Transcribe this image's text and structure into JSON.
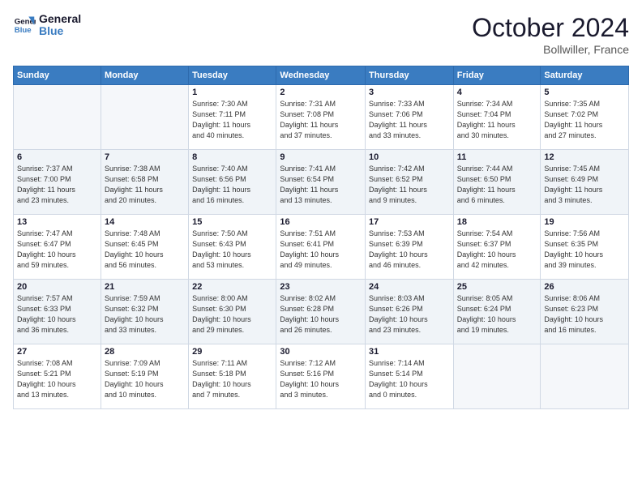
{
  "header": {
    "logo_line1": "General",
    "logo_line2": "Blue",
    "month": "October 2024",
    "location": "Bollwiller, France"
  },
  "weekdays": [
    "Sunday",
    "Monday",
    "Tuesday",
    "Wednesday",
    "Thursday",
    "Friday",
    "Saturday"
  ],
  "weeks": [
    [
      {
        "day": "",
        "info": ""
      },
      {
        "day": "",
        "info": ""
      },
      {
        "day": "1",
        "info": "Sunrise: 7:30 AM\nSunset: 7:11 PM\nDaylight: 11 hours\nand 40 minutes."
      },
      {
        "day": "2",
        "info": "Sunrise: 7:31 AM\nSunset: 7:08 PM\nDaylight: 11 hours\nand 37 minutes."
      },
      {
        "day": "3",
        "info": "Sunrise: 7:33 AM\nSunset: 7:06 PM\nDaylight: 11 hours\nand 33 minutes."
      },
      {
        "day": "4",
        "info": "Sunrise: 7:34 AM\nSunset: 7:04 PM\nDaylight: 11 hours\nand 30 minutes."
      },
      {
        "day": "5",
        "info": "Sunrise: 7:35 AM\nSunset: 7:02 PM\nDaylight: 11 hours\nand 27 minutes."
      }
    ],
    [
      {
        "day": "6",
        "info": "Sunrise: 7:37 AM\nSunset: 7:00 PM\nDaylight: 11 hours\nand 23 minutes."
      },
      {
        "day": "7",
        "info": "Sunrise: 7:38 AM\nSunset: 6:58 PM\nDaylight: 11 hours\nand 20 minutes."
      },
      {
        "day": "8",
        "info": "Sunrise: 7:40 AM\nSunset: 6:56 PM\nDaylight: 11 hours\nand 16 minutes."
      },
      {
        "day": "9",
        "info": "Sunrise: 7:41 AM\nSunset: 6:54 PM\nDaylight: 11 hours\nand 13 minutes."
      },
      {
        "day": "10",
        "info": "Sunrise: 7:42 AM\nSunset: 6:52 PM\nDaylight: 11 hours\nand 9 minutes."
      },
      {
        "day": "11",
        "info": "Sunrise: 7:44 AM\nSunset: 6:50 PM\nDaylight: 11 hours\nand 6 minutes."
      },
      {
        "day": "12",
        "info": "Sunrise: 7:45 AM\nSunset: 6:49 PM\nDaylight: 11 hours\nand 3 minutes."
      }
    ],
    [
      {
        "day": "13",
        "info": "Sunrise: 7:47 AM\nSunset: 6:47 PM\nDaylight: 10 hours\nand 59 minutes."
      },
      {
        "day": "14",
        "info": "Sunrise: 7:48 AM\nSunset: 6:45 PM\nDaylight: 10 hours\nand 56 minutes."
      },
      {
        "day": "15",
        "info": "Sunrise: 7:50 AM\nSunset: 6:43 PM\nDaylight: 10 hours\nand 53 minutes."
      },
      {
        "day": "16",
        "info": "Sunrise: 7:51 AM\nSunset: 6:41 PM\nDaylight: 10 hours\nand 49 minutes."
      },
      {
        "day": "17",
        "info": "Sunrise: 7:53 AM\nSunset: 6:39 PM\nDaylight: 10 hours\nand 46 minutes."
      },
      {
        "day": "18",
        "info": "Sunrise: 7:54 AM\nSunset: 6:37 PM\nDaylight: 10 hours\nand 42 minutes."
      },
      {
        "day": "19",
        "info": "Sunrise: 7:56 AM\nSunset: 6:35 PM\nDaylight: 10 hours\nand 39 minutes."
      }
    ],
    [
      {
        "day": "20",
        "info": "Sunrise: 7:57 AM\nSunset: 6:33 PM\nDaylight: 10 hours\nand 36 minutes."
      },
      {
        "day": "21",
        "info": "Sunrise: 7:59 AM\nSunset: 6:32 PM\nDaylight: 10 hours\nand 33 minutes."
      },
      {
        "day": "22",
        "info": "Sunrise: 8:00 AM\nSunset: 6:30 PM\nDaylight: 10 hours\nand 29 minutes."
      },
      {
        "day": "23",
        "info": "Sunrise: 8:02 AM\nSunset: 6:28 PM\nDaylight: 10 hours\nand 26 minutes."
      },
      {
        "day": "24",
        "info": "Sunrise: 8:03 AM\nSunset: 6:26 PM\nDaylight: 10 hours\nand 23 minutes."
      },
      {
        "day": "25",
        "info": "Sunrise: 8:05 AM\nSunset: 6:24 PM\nDaylight: 10 hours\nand 19 minutes."
      },
      {
        "day": "26",
        "info": "Sunrise: 8:06 AM\nSunset: 6:23 PM\nDaylight: 10 hours\nand 16 minutes."
      }
    ],
    [
      {
        "day": "27",
        "info": "Sunrise: 7:08 AM\nSunset: 5:21 PM\nDaylight: 10 hours\nand 13 minutes."
      },
      {
        "day": "28",
        "info": "Sunrise: 7:09 AM\nSunset: 5:19 PM\nDaylight: 10 hours\nand 10 minutes."
      },
      {
        "day": "29",
        "info": "Sunrise: 7:11 AM\nSunset: 5:18 PM\nDaylight: 10 hours\nand 7 minutes."
      },
      {
        "day": "30",
        "info": "Sunrise: 7:12 AM\nSunset: 5:16 PM\nDaylight: 10 hours\nand 3 minutes."
      },
      {
        "day": "31",
        "info": "Sunrise: 7:14 AM\nSunset: 5:14 PM\nDaylight: 10 hours\nand 0 minutes."
      },
      {
        "day": "",
        "info": ""
      },
      {
        "day": "",
        "info": ""
      }
    ]
  ]
}
